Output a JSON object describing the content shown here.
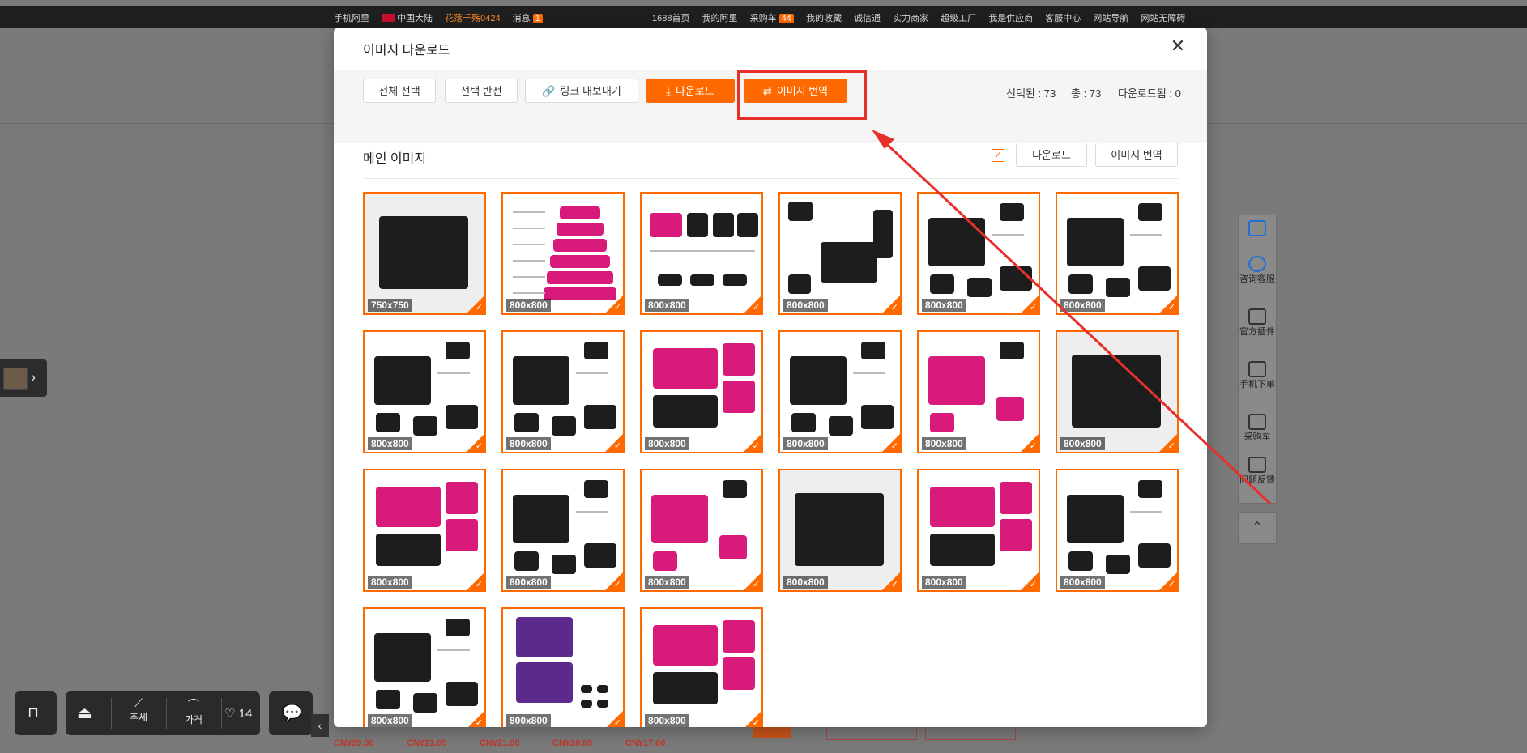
{
  "topbar": {
    "left": [
      "手机阿里",
      "中国大陆",
      "花落千殇0424",
      "消息",
      "1"
    ],
    "right": [
      "1688首页",
      "我的阿里",
      "采购车",
      "44",
      "我的收藏",
      "诚信通",
      "实力商家",
      "超级工厂",
      "我是供应商",
      "客服中心",
      "网站导航",
      "网站无障碍"
    ]
  },
  "side_tools": [
    "咨询客服",
    "官方插件",
    "手机下单",
    "采购车",
    "问题反馈"
  ],
  "bottom_bar": {
    "trend": "추세",
    "price": "가격",
    "likes": "14"
  },
  "bottom_prices": [
    "CN¥29.00",
    "CN¥21.00",
    "CN¥21.00",
    "CN¥20.80",
    "CN¥17.00"
  ],
  "modal": {
    "title": "이미지 다운로드",
    "toolbar": {
      "select_all": "전체 선택",
      "invert": "선택 반전",
      "export_links": "링크 내보내기",
      "download": "다운로드",
      "translate": "이미지 번역"
    },
    "stats": {
      "selected": "선택된 : 73",
      "total": "총 : 73",
      "downloaded": "다운로드됨 : 0"
    },
    "section": {
      "title": "메인 이미지",
      "download": "다운로드",
      "translate": "이미지 번역"
    },
    "images": [
      {
        "size": "750x750",
        "kind": "black"
      },
      {
        "size": "800x800",
        "kind": "pink-stack"
      },
      {
        "size": "800x800",
        "kind": "logo"
      },
      {
        "size": "800x800",
        "kind": "black-person"
      },
      {
        "size": "800x800",
        "kind": "black-open"
      },
      {
        "size": "800x800",
        "kind": "black-open"
      },
      {
        "size": "800x800",
        "kind": "black-open"
      },
      {
        "size": "800x800",
        "kind": "black-open"
      },
      {
        "size": "800x800",
        "kind": "pink"
      },
      {
        "size": "800x800",
        "kind": "black-open"
      },
      {
        "size": "800x800",
        "kind": "pink-open"
      },
      {
        "size": "800x800",
        "kind": "black"
      },
      {
        "size": "800x800",
        "kind": "pink"
      },
      {
        "size": "800x800",
        "kind": "black-open"
      },
      {
        "size": "800x800",
        "kind": "pink-open"
      },
      {
        "size": "800x800",
        "kind": "black"
      },
      {
        "size": "800x800",
        "kind": "pink"
      },
      {
        "size": "800x800",
        "kind": "black-open"
      },
      {
        "size": "800x800",
        "kind": "black-open"
      },
      {
        "size": "800x800",
        "kind": "purple"
      },
      {
        "size": "800x800",
        "kind": "pink"
      }
    ]
  },
  "colors": {
    "accent": "#ff6a00",
    "highlight": "#e8302a"
  }
}
